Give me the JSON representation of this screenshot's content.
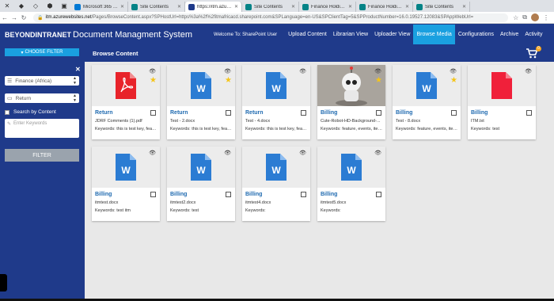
{
  "browser": {
    "tabs": [
      {
        "label": "Microsoft 365 admi",
        "color": "#0078d4",
        "active": false
      },
      {
        "label": "Site Contents",
        "color": "#038387",
        "active": false
      },
      {
        "label": "https://itm.azurew",
        "color": "#1f3a8a",
        "active": true
      },
      {
        "label": "Site Contents",
        "color": "#038387",
        "active": false
      },
      {
        "label": "Finance Holding - I",
        "color": "#038387",
        "active": false
      },
      {
        "label": "Finance Holding - I",
        "color": "#038387",
        "active": false
      },
      {
        "label": "Site Contents",
        "color": "#038387",
        "active": false
      }
    ],
    "url_host": "itm.azurewebsites.net",
    "url_path": "/Pages/BrowseContent.aspx?SPHostUrl=https%3a%2f%2fitmafricacd.sharepoint.com&SPLanguage=en-US&SPClientTag=5&SPProductNumber=16.0.19527.12083&SPAppWebUrl="
  },
  "header": {
    "brand": "BEYONDINTRANET",
    "title": "Document Managment System",
    "welcome": "Welcome To: SharePoint User",
    "nav": [
      "Upload Content",
      "Librarian View",
      "Uploader View",
      "Browse Media",
      "Configurations",
      "Archive",
      "Activity"
    ],
    "active_nav": "Browse Media"
  },
  "sidebar": {
    "choose_filter": "CHOOSE FILTER",
    "select1": "Finance (Africa)",
    "select2": "Return",
    "search_by_content": "Search by Content",
    "keywords_placeholder": "Enter Keywords",
    "filter_button": "FILTER"
  },
  "content": {
    "title": "Browse Content",
    "cart_count": "0",
    "cards": [
      {
        "type": "pdf",
        "title": "Return",
        "file": "JDRF Comments (1).pdf",
        "keywords": "Keywords: this is test key, feat...",
        "star": true
      },
      {
        "type": "word",
        "title": "Return",
        "file": "Test - 2.docx",
        "keywords": "Keywords: this is test key, feat...",
        "star": true
      },
      {
        "type": "word",
        "title": "Return",
        "file": "Test - 4.docx",
        "keywords": "Keywords: this is test key, feat...",
        "star": false
      },
      {
        "type": "photo",
        "title": "Billing",
        "file": "Cute-Robot-HD-Background-...",
        "keywords": "Keywords: feature, events, items",
        "star": true
      },
      {
        "type": "word",
        "title": "Billing",
        "file": "Test - 8.docx",
        "keywords": "Keywords: feature, events, items",
        "star": true
      },
      {
        "type": "txt",
        "title": "Billing",
        "file": "ITM.txt",
        "keywords": "Keywords: test",
        "star": false
      },
      {
        "type": "word",
        "title": "Billing",
        "file": "itmtest.docx",
        "keywords": "Keywords: test itm",
        "star": false
      },
      {
        "type": "word",
        "title": "Billing",
        "file": "itmtest2.docx",
        "keywords": "Keywords: test",
        "star": false
      },
      {
        "type": "word",
        "title": "Billing",
        "file": "itmtest4.docx",
        "keywords": "Keywords:",
        "star": false
      },
      {
        "type": "word",
        "title": "Billing",
        "file": "itmtest5.docx",
        "keywords": "Keywords:",
        "star": false
      }
    ]
  },
  "colors": {
    "brand_blue": "#1f3a8a",
    "accent": "#1aa0e0",
    "word_blue": "#2b7cd3",
    "pdf_red": "#e8232a",
    "star": "#f5c518"
  }
}
